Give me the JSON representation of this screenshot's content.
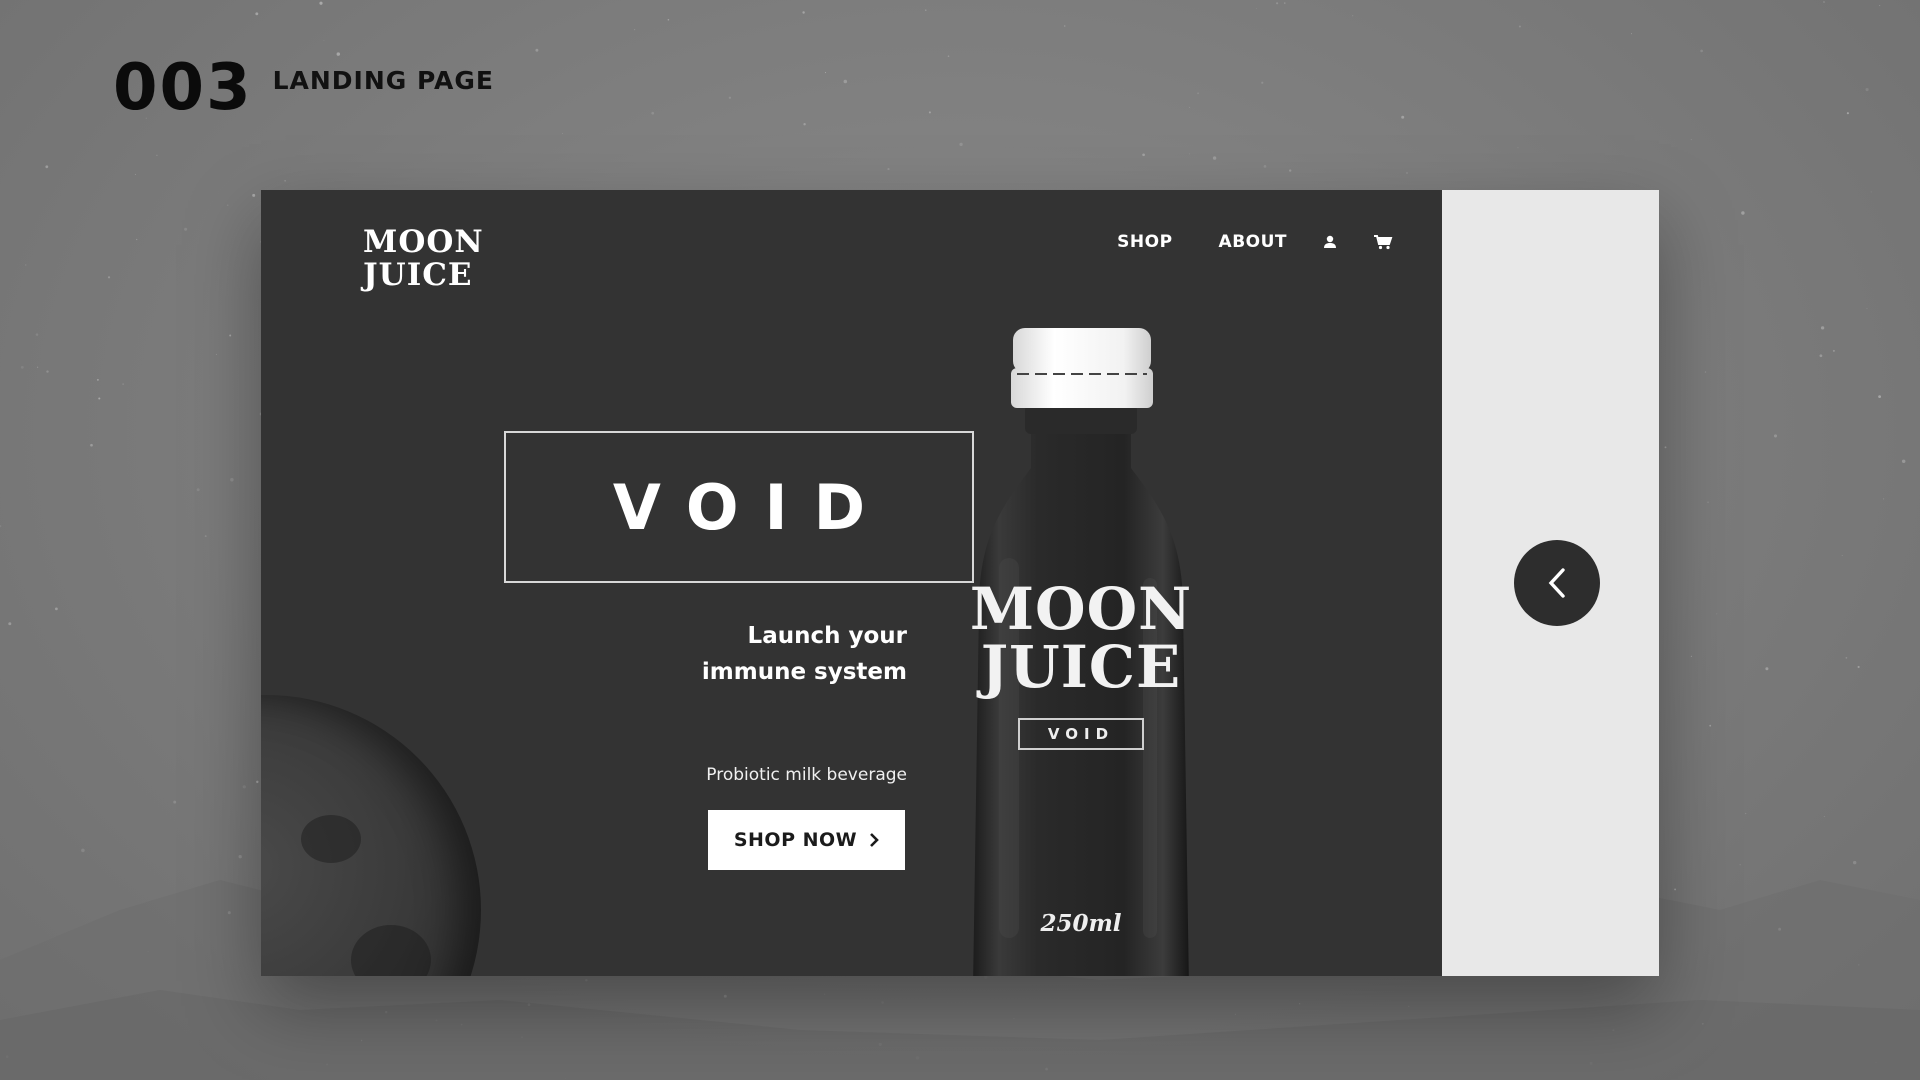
{
  "slide": {
    "number": "003",
    "title": "LANDING PAGE"
  },
  "brand": {
    "line1": "MOON",
    "line2": "JUICE"
  },
  "nav": {
    "items": [
      {
        "label": "SHOP"
      },
      {
        "label": "ABOUT"
      }
    ],
    "icons": [
      "user-icon",
      "cart-icon"
    ]
  },
  "hero": {
    "product_name": "VOID",
    "tagline_line1": "Launch your",
    "tagline_line2": "immune system",
    "subtitle": "Probiotic milk beverage",
    "cta_label": "SHOP NOW"
  },
  "bottle": {
    "brand_line1": "MOON",
    "brand_line2": "JUICE",
    "tag": "VOID",
    "volume": "250ml"
  },
  "carousel": {
    "prev_icon": "chevron-left-icon"
  },
  "colors": {
    "panel_dark": "#333333",
    "panel_light": "#e8e8e8",
    "background": "#7b7b7b",
    "button_bg": "#ffffff"
  }
}
